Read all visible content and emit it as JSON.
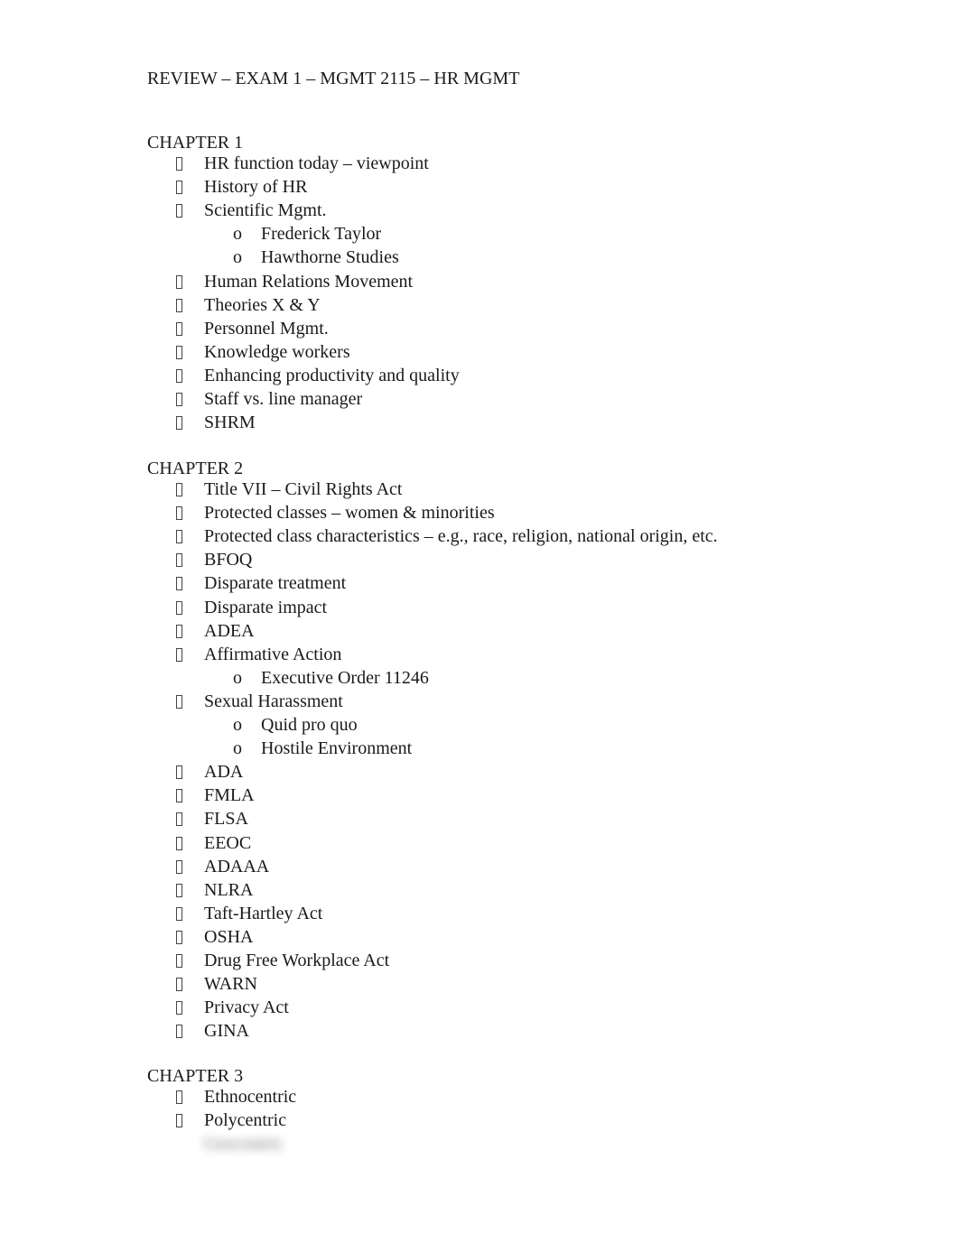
{
  "document": {
    "title": "REVIEW – EXAM 1 – MGMT 2115 – HR MGMT",
    "bullet_icon": "missing-glyph-square",
    "sub_bullet": "o",
    "chapters": [
      {
        "heading": "CHAPTER 1",
        "items": [
          {
            "label": "HR function today – viewpoint"
          },
          {
            "label": "History of HR"
          },
          {
            "label": "Scientific Mgmt.",
            "sub": [
              "Frederick Taylor",
              "Hawthorne Studies"
            ]
          },
          {
            "label": "Human Relations Movement"
          },
          {
            "label": "Theories X & Y"
          },
          {
            "label": "Personnel Mgmt."
          },
          {
            "label": "Knowledge workers"
          },
          {
            "label": "Enhancing productivity and quality"
          },
          {
            "label": "Staff vs. line manager"
          },
          {
            "label": "SHRM"
          }
        ]
      },
      {
        "heading": "CHAPTER 2",
        "items": [
          {
            "label": "Title VII – Civil Rights Act"
          },
          {
            "label": "Protected classes – women & minorities"
          },
          {
            "label": "Protected class characteristics – e.g., race, religion, national origin, etc."
          },
          {
            "label": "BFOQ"
          },
          {
            "label": "Disparate treatment"
          },
          {
            "label": "Disparate impact"
          },
          {
            "label": "ADEA"
          },
          {
            "label": "Affirmative Action",
            "sub": [
              "Executive Order 11246"
            ]
          },
          {
            "label": "Sexual Harassment",
            "sub": [
              "Quid pro quo",
              "Hostile Environment"
            ]
          },
          {
            "label": "ADA"
          },
          {
            "label": "FMLA"
          },
          {
            "label": "FLSA"
          },
          {
            "label": "EEOC"
          },
          {
            "label": "ADAAA"
          },
          {
            "label": "NLRA"
          },
          {
            "label": "Taft-Hartley Act"
          },
          {
            "label": "OSHA"
          },
          {
            "label": "Drug Free Workplace Act"
          },
          {
            "label": "WARN"
          },
          {
            "label": "Privacy Act"
          },
          {
            "label": "GINA"
          }
        ]
      },
      {
        "heading": "CHAPTER 3",
        "items": [
          {
            "label": "Ethnocentric"
          },
          {
            "label": "Polycentric"
          },
          {
            "label": "Geocentric",
            "obscured": true
          }
        ]
      }
    ]
  }
}
